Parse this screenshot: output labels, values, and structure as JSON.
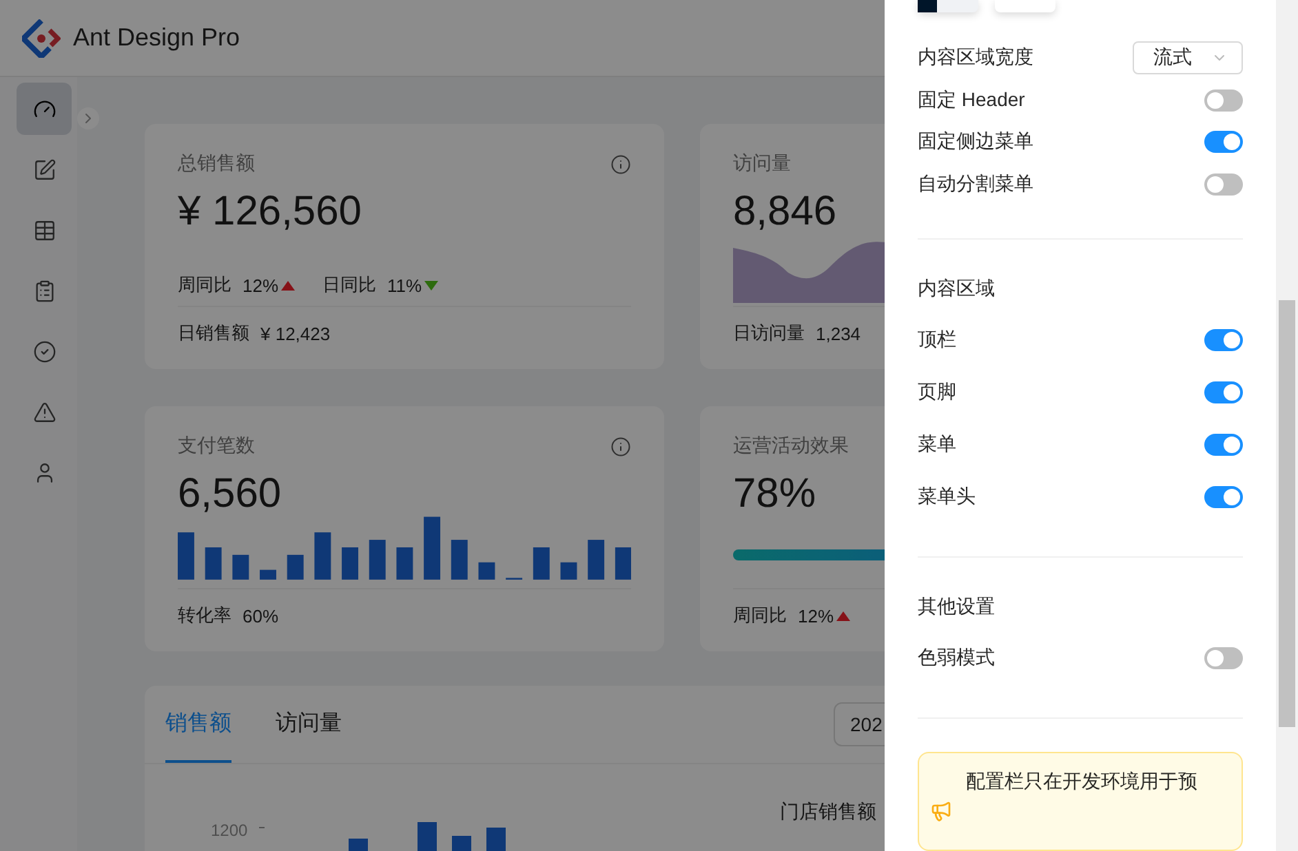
{
  "header": {
    "title": "Ant Design Pro"
  },
  "sidebar": {
    "items": [
      {
        "kind": "dashboard",
        "selected": true
      },
      {
        "kind": "form",
        "selected": false
      },
      {
        "kind": "table",
        "selected": false
      },
      {
        "kind": "list",
        "selected": false
      },
      {
        "kind": "result",
        "selected": false
      },
      {
        "kind": "exception",
        "selected": false
      },
      {
        "kind": "account",
        "selected": false
      }
    ]
  },
  "stat_cards": [
    {
      "kind": "trend",
      "title": "总销售额",
      "value": "¥ 126,560",
      "trends": [
        {
          "label": "周同比",
          "value": "12%",
          "kind": "up"
        },
        {
          "label": "日同比",
          "value": "11%",
          "kind": "down"
        }
      ],
      "footer_label": "日销售额",
      "footer_value": "¥ 12,423"
    },
    {
      "kind": "area",
      "title": "访问量",
      "value": "8,846",
      "footer_label": "日访问量",
      "footer_value": "1,234"
    },
    {
      "kind": "bars",
      "title": "支付笔数",
      "value": "6,560",
      "footer_label": "转化率",
      "footer_value": "60%"
    },
    {
      "kind": "progress",
      "title": "运营活动效果",
      "value": "78%",
      "level": 0.78,
      "trends": [
        {
          "label": "周同比",
          "value": "12%",
          "kind": "up"
        }
      ]
    }
  ],
  "sales_panel": {
    "tabs": [
      {
        "label": "销售额",
        "selected": true
      },
      {
        "label": "访问量",
        "selected": false
      }
    ],
    "date_field": "202",
    "tick": "1200",
    "ranking_title": "门店销售额"
  },
  "drawer": {
    "content_width": {
      "label": "内容区域宽度",
      "value": "流式"
    },
    "toggles": [
      {
        "label": "固定 Header",
        "on": false
      },
      {
        "label": "固定侧边菜单",
        "on": true
      },
      {
        "label": "自动分割菜单",
        "on": false
      }
    ],
    "sections": [
      {
        "title": "内容区域",
        "toggles": [
          {
            "label": "顶栏",
            "on": true
          },
          {
            "label": "页脚",
            "on": true
          },
          {
            "label": "菜单",
            "on": true
          },
          {
            "label": "菜单头",
            "on": true
          }
        ]
      },
      {
        "title": "其他设置",
        "toggles": [
          {
            "label": "色弱模式",
            "on": false
          }
        ]
      }
    ],
    "alert": "配置栏只在开发环境用于预"
  }
}
